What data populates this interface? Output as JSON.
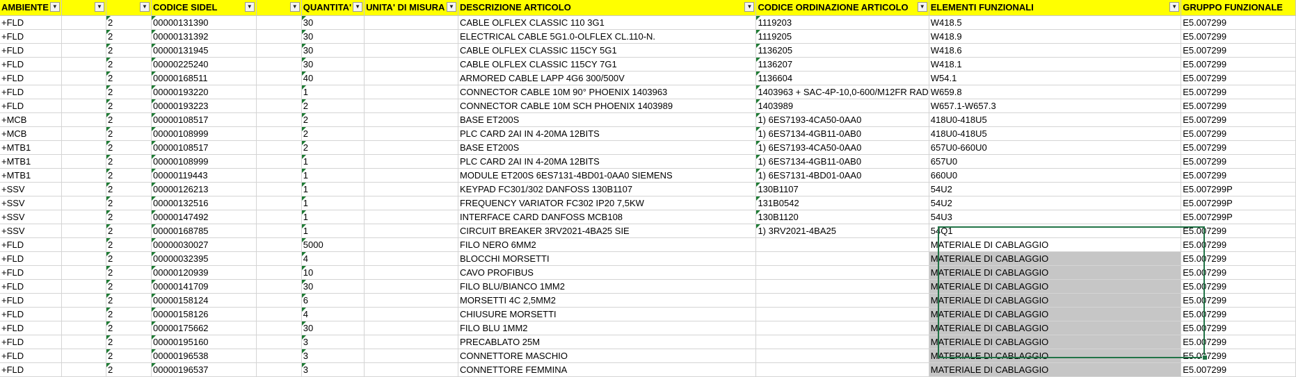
{
  "headers": [
    "AMBIENTE",
    "",
    "",
    "CODICE SIDEL",
    "",
    "QUANTITA'",
    "UNITA' DI MISURA",
    "DESCRIZIONE ARTICOLO",
    "CODICE ORDINAZIONE ARTICOLO",
    "ELEMENTI FUNZIONALI",
    "GRUPPO FUNZIONALE"
  ],
  "rows": [
    [
      "+FLD",
      "",
      "2",
      "00000131390",
      "",
      "30",
      "",
      "CABLE OLFLEX CLASSIC 110 3G1",
      "1119203",
      "W418.5",
      "E5.007299"
    ],
    [
      "+FLD",
      "",
      "2",
      "00000131392",
      "",
      "30",
      "",
      "ELECTRICAL CABLE 5G1.0-OLFLEX CL.110-N.",
      "1119205",
      "W418.9",
      "E5.007299"
    ],
    [
      "+FLD",
      "",
      "2",
      "00000131945",
      "",
      "30",
      "",
      "CABLE OLFLEX CLASSIC 115CY 5G1",
      "1136205",
      "W418.6",
      "E5.007299"
    ],
    [
      "+FLD",
      "",
      "2",
      "00000225240",
      "",
      "30",
      "",
      "CABLE OLFLEX CLASSIC 115CY 7G1",
      "1136207",
      "W418.1",
      "E5.007299"
    ],
    [
      "+FLD",
      "",
      "2",
      "00000168511",
      "",
      "40",
      "",
      "ARMORED CABLE LAPP 4G6 300/500V",
      "1136604",
      "W54.1",
      "E5.007299"
    ],
    [
      "+FLD",
      "",
      "2",
      "00000193220",
      "",
      "1",
      "",
      "CONNECTOR CABLE 10M 90° PHOENIX 1403963",
      "1403963 + SAC-4P-10,0-600/M12FR RAD",
      "W659.8",
      "E5.007299"
    ],
    [
      "+FLD",
      "",
      "2",
      "00000193223",
      "",
      "2",
      "",
      "CONNECTOR CABLE 10M SCH PHOENIX 1403989",
      "1403989",
      "W657.1-W657.3",
      "E5.007299"
    ],
    [
      "+MCB",
      "",
      "2",
      "00000108517",
      "",
      "2",
      "",
      "BASE ET200S",
      "1) 6ES7193-4CA50-0AA0",
      "418U0-418U5",
      "E5.007299"
    ],
    [
      "+MCB",
      "",
      "2",
      "00000108999",
      "",
      "2",
      "",
      "PLC CARD 2AI IN 4-20MA 12BITS",
      "1) 6ES7134-4GB11-0AB0",
      "418U0-418U5",
      "E5.007299"
    ],
    [
      "+MTB1",
      "",
      "2",
      "00000108517",
      "",
      "2",
      "",
      "BASE ET200S",
      "1) 6ES7193-4CA50-0AA0",
      "657U0-660U0",
      "E5.007299"
    ],
    [
      "+MTB1",
      "",
      "2",
      "00000108999",
      "",
      "1",
      "",
      "PLC CARD 2AI IN 4-20MA 12BITS",
      "1) 6ES7134-4GB11-0AB0",
      "657U0",
      "E5.007299"
    ],
    [
      "+MTB1",
      "",
      "2",
      "00000119443",
      "",
      "1",
      "",
      "MODULE ET200S 6ES7131-4BD01-0AA0 SIEMENS",
      "1) 6ES7131-4BD01-0AA0",
      "660U0",
      "E5.007299"
    ],
    [
      "+SSV",
      "",
      "2",
      "00000126213",
      "",
      "1",
      "",
      "KEYPAD FC301/302 DANFOSS 130B1107",
      "130B1107",
      "54U2",
      "E5.007299P"
    ],
    [
      "+SSV",
      "",
      "2",
      "00000132516",
      "",
      "1",
      "",
      "FREQUENCY VARIATOR FC302 IP20 7,5KW",
      "131B0542",
      "54U2",
      "E5.007299P"
    ],
    [
      "+SSV",
      "",
      "2",
      "00000147492",
      "",
      "1",
      "",
      "INTERFACE CARD DANFOSS MCB108",
      "130B1120",
      "54U3",
      "E5.007299P"
    ],
    [
      "+SSV",
      "",
      "2",
      "00000168785",
      "",
      "1",
      "",
      "CIRCUIT BREAKER 3RV2021-4BA25 SIE",
      "1) 3RV2021-4BA25",
      "54Q1",
      "E5.007299"
    ],
    [
      "+FLD",
      "",
      "2",
      "00000030027",
      "",
      "5000",
      "",
      "FILO NERO 6MM2",
      "",
      "MATERIALE DI CABLAGGIO",
      "E5.007299"
    ],
    [
      "+FLD",
      "",
      "2",
      "00000032395",
      "",
      "4",
      "",
      "BLOCCHI MORSETTI",
      "",
      "MATERIALE DI CABLAGGIO",
      "E5.007299"
    ],
    [
      "+FLD",
      "",
      "2",
      "00000120939",
      "",
      "10",
      "",
      "CAVO PROFIBUS",
      "",
      "MATERIALE DI CABLAGGIO",
      "E5.007299"
    ],
    [
      "+FLD",
      "",
      "2",
      "00000141709",
      "",
      "30",
      "",
      "FILO BLU/BIANCO 1MM2",
      "",
      "MATERIALE DI CABLAGGIO",
      "E5.007299"
    ],
    [
      "+FLD",
      "",
      "2",
      "00000158124",
      "",
      "6",
      "",
      "MORSETTI 4C 2,5MM2",
      "",
      "MATERIALE DI CABLAGGIO",
      "E5.007299"
    ],
    [
      "+FLD",
      "",
      "2",
      "00000158126",
      "",
      "4",
      "",
      "CHIUSURE MORSETTI",
      "",
      "MATERIALE DI CABLAGGIO",
      "E5.007299"
    ],
    [
      "+FLD",
      "",
      "2",
      "00000175662",
      "",
      "30",
      "",
      "FILO BLU 1MM2",
      "",
      "MATERIALE DI CABLAGGIO",
      "E5.007299"
    ],
    [
      "+FLD",
      "",
      "2",
      "00000195160",
      "",
      "3",
      "",
      "PRECABLATO 25M",
      "",
      "MATERIALE DI CABLAGGIO",
      "E5.007299"
    ],
    [
      "+FLD",
      "",
      "2",
      "00000196538",
      "",
      "3",
      "",
      "CONNETTORE MASCHIO",
      "",
      "MATERIALE DI CABLAGGIO",
      "E5.007299"
    ],
    [
      "+FLD",
      "",
      "2",
      "00000196537",
      "",
      "3",
      "",
      "CONNETTORE FEMMINA",
      "",
      "MATERIALE DI CABLAGGIO",
      "E5.007299"
    ]
  ],
  "filter_icon": "dropdown-arrow-icon",
  "colors": {
    "header_background": "#ffff00",
    "selection_border": "#217346",
    "selection_fill": "#c6c6c6",
    "text_marker": "#1e7b34"
  }
}
